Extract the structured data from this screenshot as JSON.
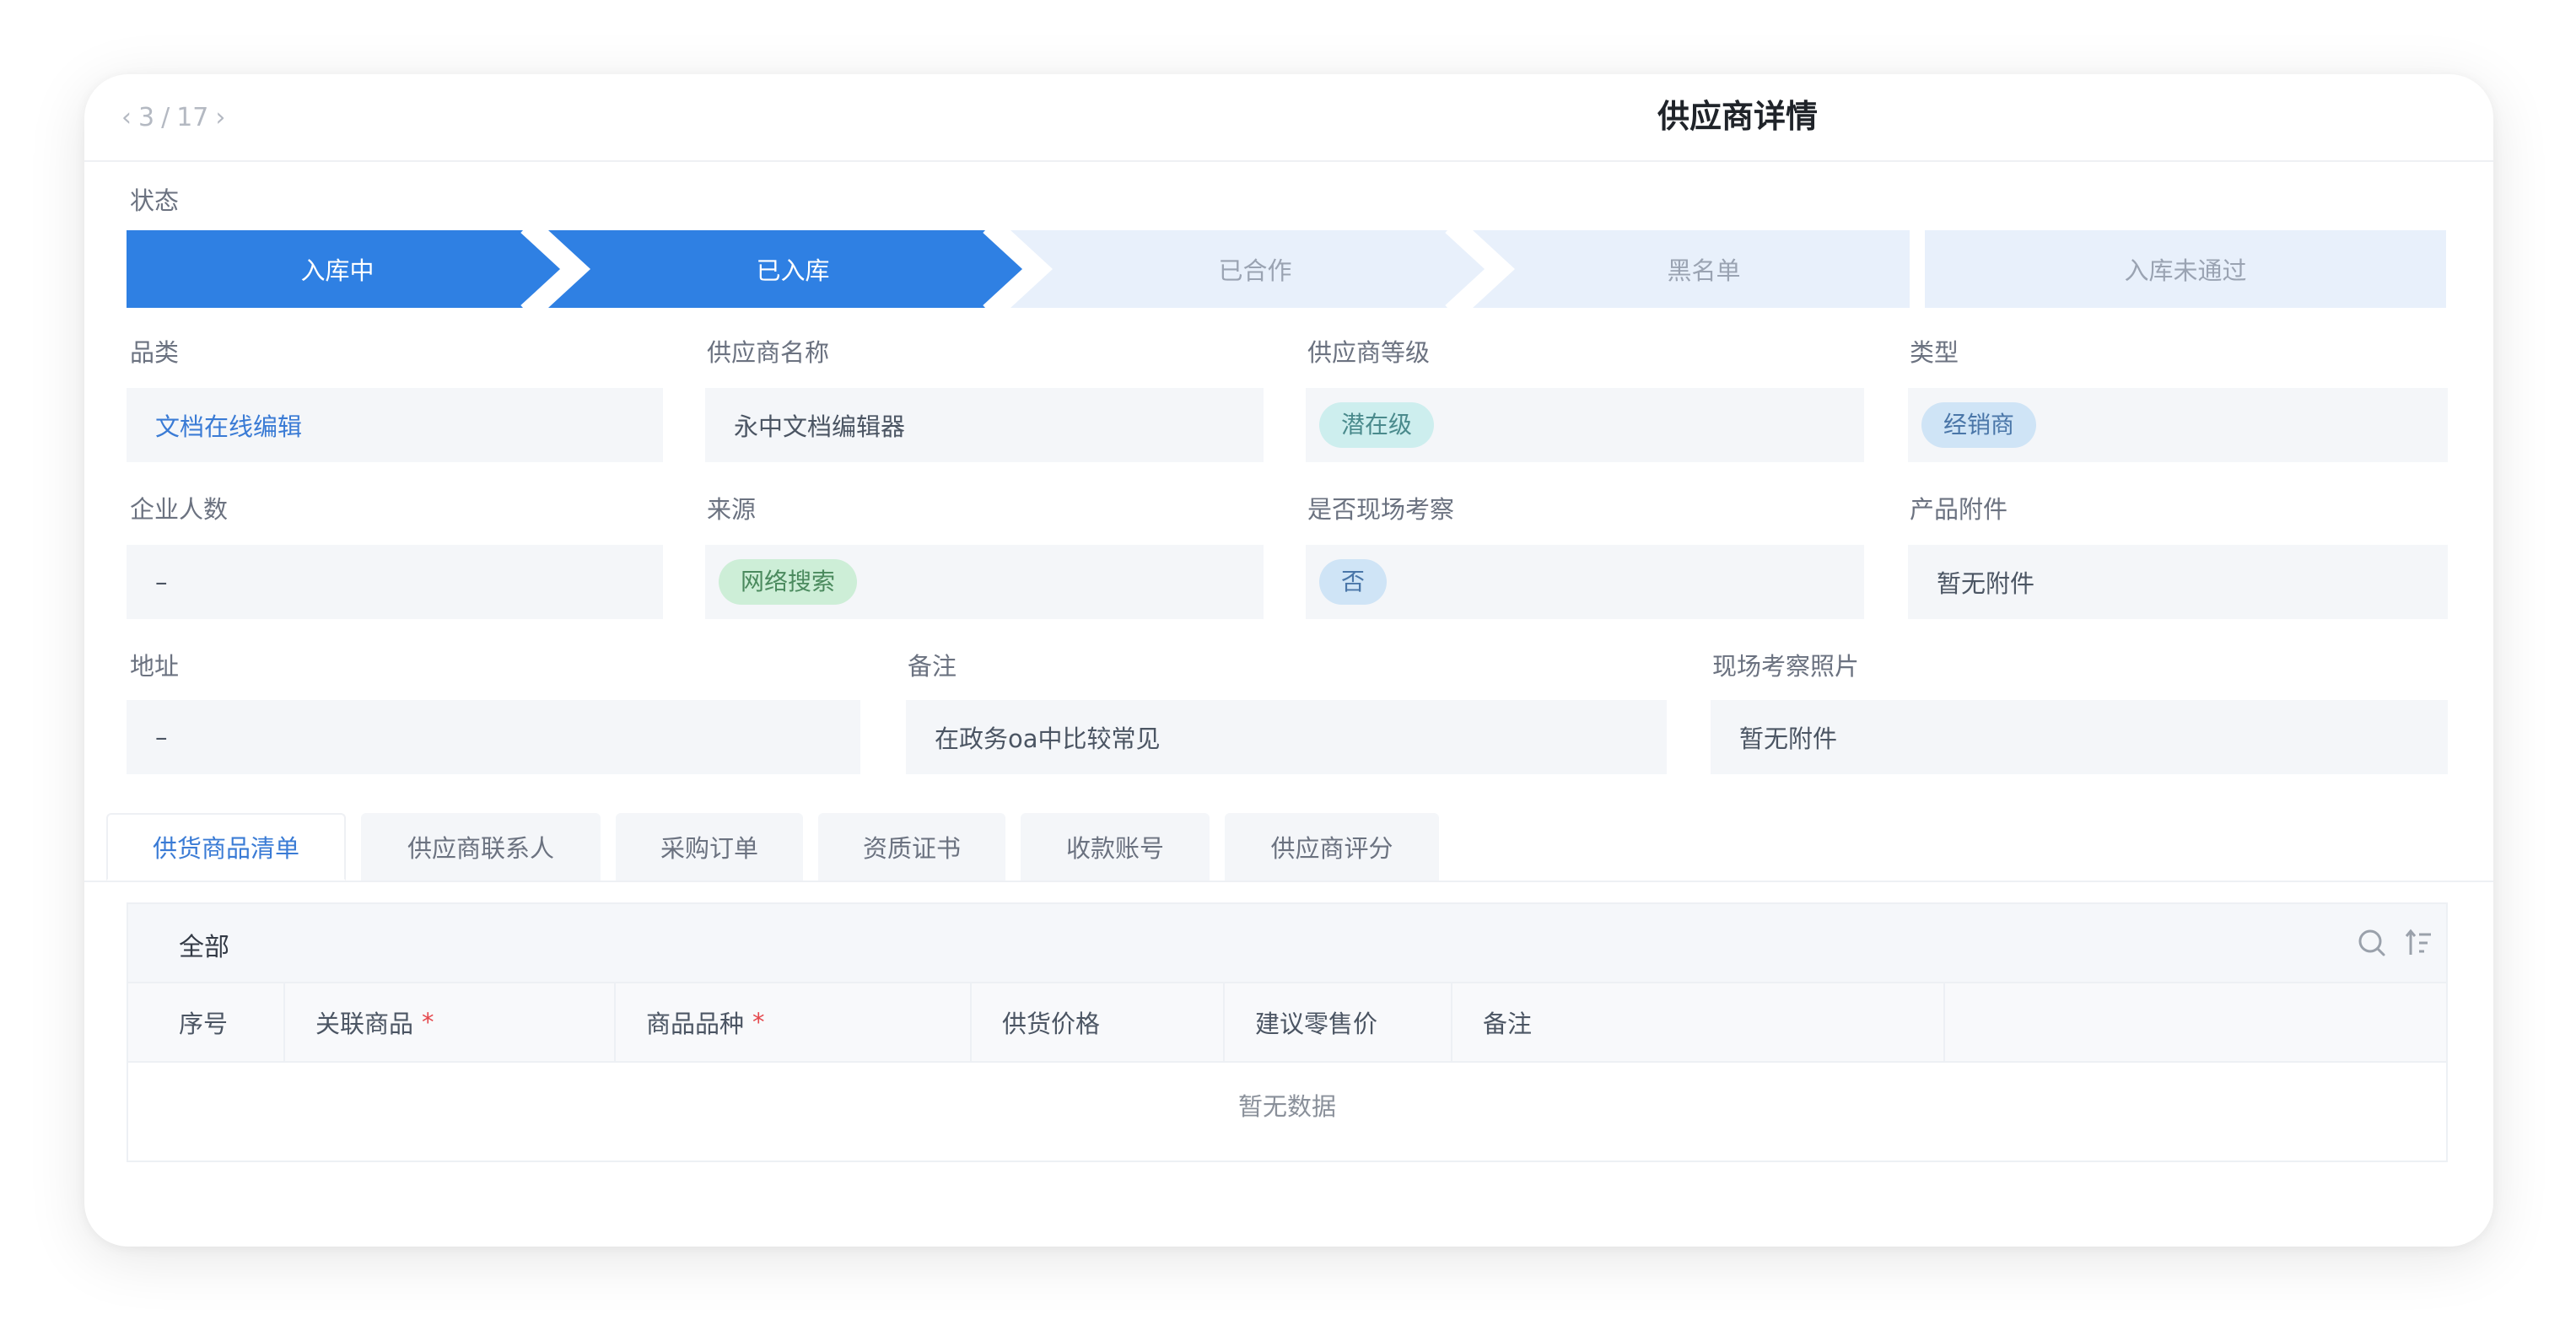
{
  "header": {
    "pager": {
      "prev": "‹",
      "current": "3",
      "separator": "/",
      "total": "17",
      "next": "›"
    },
    "title": "供应商详情"
  },
  "status": {
    "label": "状态",
    "steps": [
      {
        "label": "入库中",
        "active": true
      },
      {
        "label": "已入库",
        "active": true
      },
      {
        "label": "已合作",
        "active": false
      },
      {
        "label": "黑名单",
        "active": false
      },
      {
        "label": "入库未通过",
        "active": false
      }
    ],
    "colors": {
      "active": "#2f80e3",
      "inactive": "#e8f0fb"
    }
  },
  "fields": {
    "category": {
      "label": "品类",
      "value": "文档在线编辑"
    },
    "supplier_name": {
      "label": "供应商名称",
      "value": "永中文档编辑器"
    },
    "supplier_level": {
      "label": "供应商等级",
      "value": "潜在级"
    },
    "type": {
      "label": "类型",
      "value": "经销商"
    },
    "employee_count": {
      "label": "企业人数",
      "value": "–"
    },
    "source": {
      "label": "来源",
      "value": "网络搜索"
    },
    "site_inspection": {
      "label": "是否现场考察",
      "value": "否"
    },
    "product_attachment": {
      "label": "产品附件",
      "value": "暂无附件"
    },
    "address": {
      "label": "地址",
      "value": "–"
    },
    "remark": {
      "label": "备注",
      "value": "在政务oa中比较常见"
    },
    "inspection_photos": {
      "label": "现场考察照片",
      "value": "暂无附件"
    }
  },
  "tabs": [
    {
      "label": "供货商品清单",
      "active": true
    },
    {
      "label": "供应商联系人",
      "active": false
    },
    {
      "label": "采购订单",
      "active": false
    },
    {
      "label": "资质证书",
      "active": false
    },
    {
      "label": "收款账号",
      "active": false
    },
    {
      "label": "供应商评分",
      "active": false
    }
  ],
  "table": {
    "filter_label": "全部",
    "icons": [
      "search-icon",
      "sort-icon"
    ],
    "columns": [
      {
        "label": "序号",
        "required": false
      },
      {
        "label": "关联商品",
        "required": true
      },
      {
        "label": "商品品种",
        "required": true
      },
      {
        "label": "供货价格",
        "required": false
      },
      {
        "label": "建议零售价",
        "required": false
      },
      {
        "label": "备注",
        "required": false
      }
    ],
    "empty_text": "暂无数据"
  },
  "colors": {
    "accent": "#2f80e3",
    "link": "#3a7bd5",
    "required": "#e5484d"
  }
}
